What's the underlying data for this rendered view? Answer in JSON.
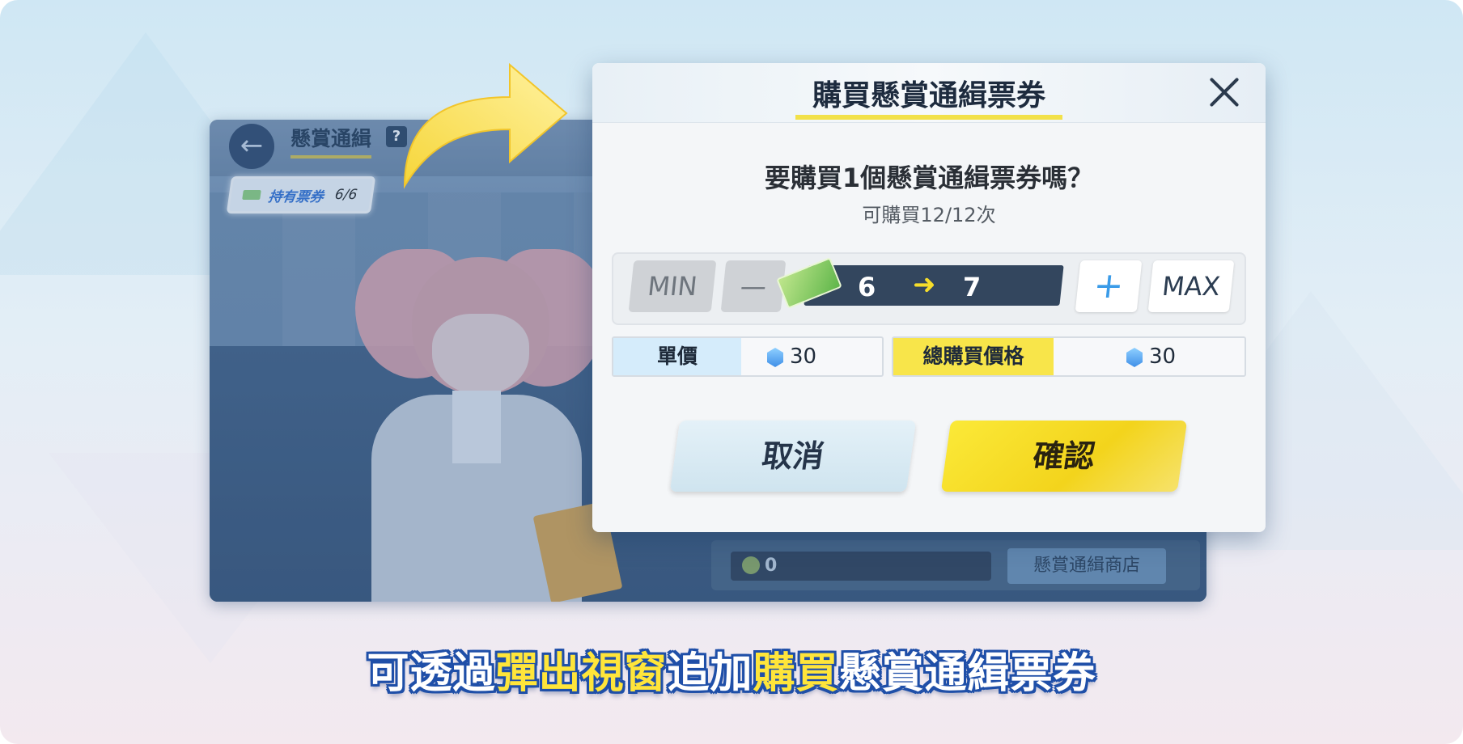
{
  "background_screen": {
    "title": "懸賞通緝",
    "help_badge": "?",
    "tickets_held_label": "持有票券",
    "tickets_held_value": "6/6",
    "currency_amount": "0",
    "shop_button": "懸賞通緝商店"
  },
  "dialog": {
    "title": "購買懸賞通緝票券",
    "question": "要購買1個懸賞通緝票券嗎？",
    "purchase_limit": "可購買12/12次",
    "stepper": {
      "min_label": "MIN",
      "minus_label": "—",
      "plus_label": "+",
      "max_label": "MAX",
      "from_count": "6",
      "arrow": "➜",
      "to_count": "7"
    },
    "unit_price_label": "單價",
    "unit_price_value": "30",
    "total_price_label": "總購買價格",
    "total_price_value": "30",
    "cancel_label": "取消",
    "confirm_label": "確認"
  },
  "caption": {
    "part1": "可透過",
    "part2_highlight": "彈出視窗",
    "part3": "追加",
    "part4_highlight": "購買",
    "part5": "懸賞通緝票券"
  },
  "colors": {
    "accent_yellow": "#f8e54a",
    "caption_outline": "#1f4fa8",
    "dialog_bg": "#f4f6f8"
  }
}
